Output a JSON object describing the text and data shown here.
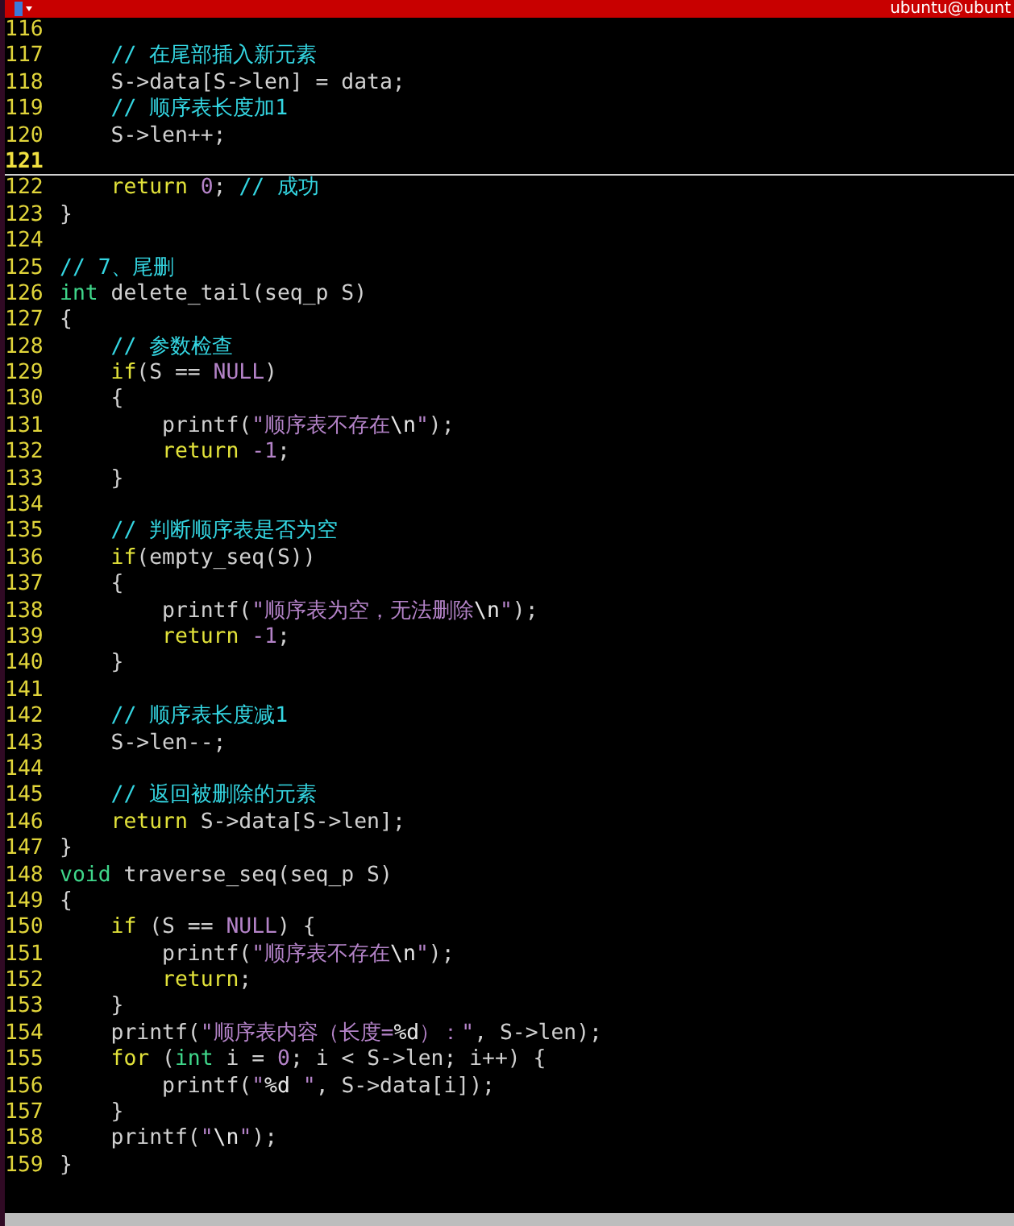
{
  "title_bar": {
    "title": "ubuntu@ubunt"
  },
  "editor": {
    "lines": [
      {
        "number": "116",
        "current": false
      },
      {
        "number": "117",
        "current": false,
        "segments": [
          {
            "kind": "comment",
            "text": "    // 在尾部插入新元素"
          }
        ]
      },
      {
        "number": "118",
        "current": false,
        "segments": [
          {
            "kind": "plain",
            "text": "    S->data[S->len] = data;"
          }
        ]
      },
      {
        "number": "119",
        "current": false,
        "segments": [
          {
            "kind": "comment",
            "text": "    // 顺序表长度加1"
          }
        ]
      },
      {
        "number": "120",
        "current": false,
        "segments": [
          {
            "kind": "plain",
            "text": "    S->len++;"
          }
        ]
      },
      {
        "number": "121",
        "current": true
      },
      {
        "number": "122",
        "current": false,
        "segments": [
          {
            "kind": "keyword",
            "text": "    return"
          },
          {
            "kind": "number",
            "text": " 0"
          },
          {
            "kind": "plain",
            "text": ";"
          },
          {
            "kind": "comment",
            "text": " // 成功"
          }
        ]
      },
      {
        "number": "123",
        "current": false,
        "segments": [
          {
            "kind": "plain",
            "text": "}"
          }
        ]
      },
      {
        "number": "124",
        "current": false
      },
      {
        "number": "125",
        "current": false,
        "segments": [
          {
            "kind": "comment",
            "text": "// 7、尾删"
          }
        ]
      },
      {
        "number": "126",
        "current": false,
        "segments": [
          {
            "kind": "type",
            "text": "int"
          },
          {
            "kind": "plain",
            "text": " delete_tail(seq_p S)"
          }
        ]
      },
      {
        "number": "127",
        "current": false,
        "segments": [
          {
            "kind": "plain",
            "text": "{"
          }
        ]
      },
      {
        "number": "128",
        "current": false,
        "segments": [
          {
            "kind": "comment",
            "text": "    // 参数检查"
          }
        ]
      },
      {
        "number": "129",
        "current": false,
        "segments": [
          {
            "kind": "keyword",
            "text": "    if"
          },
          {
            "kind": "plain",
            "text": "(S == "
          },
          {
            "kind": "constant",
            "text": "NULL"
          },
          {
            "kind": "plain",
            "text": ")"
          }
        ]
      },
      {
        "number": "130",
        "current": false,
        "segments": [
          {
            "kind": "plain",
            "text": "    {"
          }
        ]
      },
      {
        "number": "131",
        "current": false,
        "segments": [
          {
            "kind": "plain",
            "text": "        printf("
          },
          {
            "kind": "string",
            "text": "\"顺序表不存在"
          },
          {
            "kind": "special",
            "text": "\\n"
          },
          {
            "kind": "string",
            "text": "\""
          },
          {
            "kind": "plain",
            "text": ");"
          }
        ]
      },
      {
        "number": "132",
        "current": false,
        "segments": [
          {
            "kind": "keyword",
            "text": "        return"
          },
          {
            "kind": "number",
            "text": " -1"
          },
          {
            "kind": "plain",
            "text": ";"
          }
        ]
      },
      {
        "number": "133",
        "current": false,
        "segments": [
          {
            "kind": "plain",
            "text": "    }"
          }
        ]
      },
      {
        "number": "134",
        "current": false
      },
      {
        "number": "135",
        "current": false,
        "segments": [
          {
            "kind": "comment",
            "text": "    // 判断顺序表是否为空"
          }
        ]
      },
      {
        "number": "136",
        "current": false,
        "segments": [
          {
            "kind": "keyword",
            "text": "    if"
          },
          {
            "kind": "plain",
            "text": "(empty_seq(S))"
          }
        ]
      },
      {
        "number": "137",
        "current": false,
        "segments": [
          {
            "kind": "plain",
            "text": "    {"
          }
        ]
      },
      {
        "number": "138",
        "current": false,
        "segments": [
          {
            "kind": "plain",
            "text": "        printf("
          },
          {
            "kind": "string",
            "text": "\"顺序表为空，无法删除"
          },
          {
            "kind": "special",
            "text": "\\n"
          },
          {
            "kind": "string",
            "text": "\""
          },
          {
            "kind": "plain",
            "text": ");"
          }
        ]
      },
      {
        "number": "139",
        "current": false,
        "segments": [
          {
            "kind": "keyword",
            "text": "        return"
          },
          {
            "kind": "number",
            "text": " -1"
          },
          {
            "kind": "plain",
            "text": ";"
          }
        ]
      },
      {
        "number": "140",
        "current": false,
        "segments": [
          {
            "kind": "plain",
            "text": "    }"
          }
        ]
      },
      {
        "number": "141",
        "current": false
      },
      {
        "number": "142",
        "current": false,
        "segments": [
          {
            "kind": "comment",
            "text": "    // 顺序表长度减1"
          }
        ]
      },
      {
        "number": "143",
        "current": false,
        "segments": [
          {
            "kind": "plain",
            "text": "    S->len--;"
          }
        ]
      },
      {
        "number": "144",
        "current": false
      },
      {
        "number": "145",
        "current": false,
        "segments": [
          {
            "kind": "comment",
            "text": "    // 返回被删除的元素"
          }
        ]
      },
      {
        "number": "146",
        "current": false,
        "segments": [
          {
            "kind": "keyword",
            "text": "    return"
          },
          {
            "kind": "plain",
            "text": " S->data[S->len];"
          }
        ]
      },
      {
        "number": "147",
        "current": false,
        "segments": [
          {
            "kind": "plain",
            "text": "}"
          }
        ]
      },
      {
        "number": "148",
        "current": false,
        "segments": [
          {
            "kind": "type",
            "text": "void"
          },
          {
            "kind": "plain",
            "text": " traverse_seq(seq_p S)"
          }
        ]
      },
      {
        "number": "149",
        "current": false,
        "segments": [
          {
            "kind": "plain",
            "text": "{"
          }
        ]
      },
      {
        "number": "150",
        "current": false,
        "segments": [
          {
            "kind": "keyword",
            "text": "    if"
          },
          {
            "kind": "plain",
            "text": " (S == "
          },
          {
            "kind": "constant",
            "text": "NULL"
          },
          {
            "kind": "plain",
            "text": ") {"
          }
        ]
      },
      {
        "number": "151",
        "current": false,
        "segments": [
          {
            "kind": "plain",
            "text": "        printf("
          },
          {
            "kind": "string",
            "text": "\"顺序表不存在"
          },
          {
            "kind": "special",
            "text": "\\n"
          },
          {
            "kind": "string",
            "text": "\""
          },
          {
            "kind": "plain",
            "text": ");"
          }
        ]
      },
      {
        "number": "152",
        "current": false,
        "segments": [
          {
            "kind": "keyword",
            "text": "        return"
          },
          {
            "kind": "plain",
            "text": ";"
          }
        ]
      },
      {
        "number": "153",
        "current": false,
        "segments": [
          {
            "kind": "plain",
            "text": "    }"
          }
        ]
      },
      {
        "number": "154",
        "current": false,
        "segments": [
          {
            "kind": "plain",
            "text": "    printf("
          },
          {
            "kind": "string",
            "text": "\"顺序表内容（长度="
          },
          {
            "kind": "special",
            "text": "%d"
          },
          {
            "kind": "string",
            "text": "）：\""
          },
          {
            "kind": "plain",
            "text": ", S->len);"
          }
        ]
      },
      {
        "number": "155",
        "current": false,
        "segments": [
          {
            "kind": "keyword",
            "text": "    for"
          },
          {
            "kind": "plain",
            "text": " ("
          },
          {
            "kind": "type",
            "text": "int"
          },
          {
            "kind": "plain",
            "text": " i = "
          },
          {
            "kind": "number",
            "text": "0"
          },
          {
            "kind": "plain",
            "text": "; i < S->len; i++) {"
          }
        ]
      },
      {
        "number": "156",
        "current": false,
        "segments": [
          {
            "kind": "plain",
            "text": "        printf("
          },
          {
            "kind": "string",
            "text": "\""
          },
          {
            "kind": "special",
            "text": "%d"
          },
          {
            "kind": "string",
            "text": " \""
          },
          {
            "kind": "plain",
            "text": ", S->data[i]);"
          }
        ]
      },
      {
        "number": "157",
        "current": false,
        "segments": [
          {
            "kind": "plain",
            "text": "    }"
          }
        ]
      },
      {
        "number": "158",
        "current": false,
        "segments": [
          {
            "kind": "plain",
            "text": "    printf("
          },
          {
            "kind": "string",
            "text": "\""
          },
          {
            "kind": "special",
            "text": "\\n"
          },
          {
            "kind": "string",
            "text": "\""
          },
          {
            "kind": "plain",
            "text": ");"
          }
        ]
      },
      {
        "number": "159",
        "current": false,
        "segments": [
          {
            "kind": "plain",
            "text": "}"
          }
        ]
      }
    ]
  }
}
